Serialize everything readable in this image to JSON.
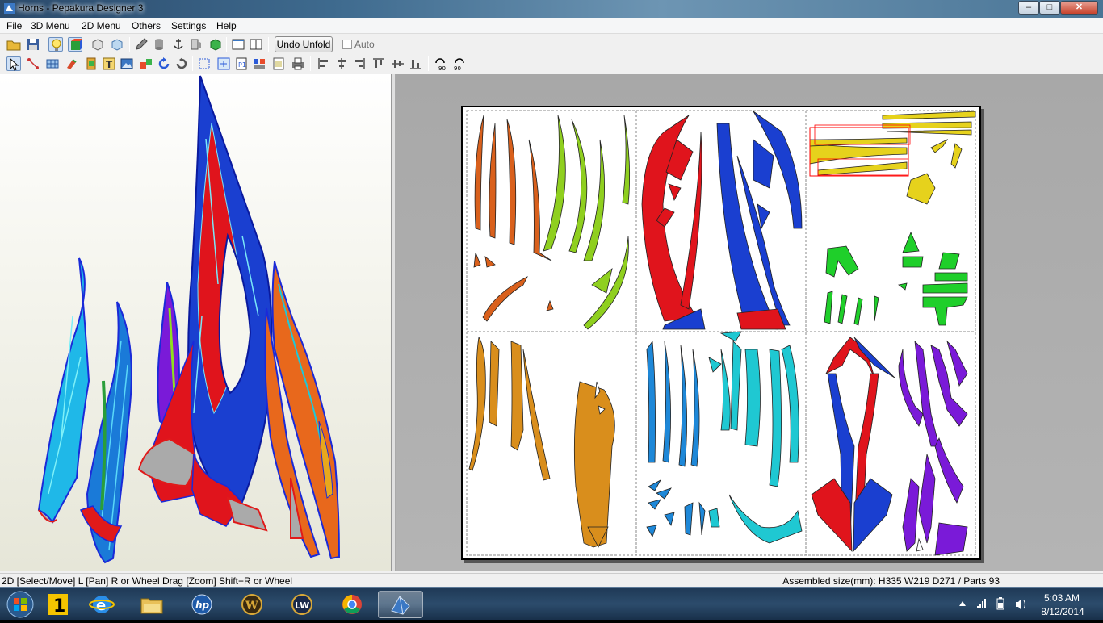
{
  "window": {
    "title": "Horns - Pepakura Designer 3",
    "min_label": "–",
    "max_label": "□",
    "close_label": "✕"
  },
  "menu": {
    "items": [
      "File",
      "3D Menu",
      "2D Menu",
      "Others",
      "Settings",
      "Help"
    ]
  },
  "toolbar": {
    "undo_label": "Undo Unfold",
    "auto_label": "Auto",
    "auto_checked": false
  },
  "status": {
    "left": "2D [Select/Move] L [Pan] R or Wheel Drag [Zoom] Shift+R or Wheel",
    "right": "Assembled size(mm): H335 W219 D271 / Parts 93"
  },
  "taskbar": {
    "time": "5:03 AM",
    "date": "8/12/2014",
    "apps": [
      "start-orb",
      "norton-one",
      "internet-explorer",
      "file-explorer",
      "hp",
      "wow",
      "lw",
      "chrome",
      "pepakura"
    ]
  },
  "colors": {
    "titlebar": "#3e6a8e",
    "viewport2d_bg": "#b0b0b0",
    "part_orange": "#d9601c",
    "part_green": "#8fcf1f",
    "part_red": "#e0141c",
    "part_blue": "#1a3fd0",
    "part_yellow": "#e6d21c",
    "part_bright_green": "#1fcf2a",
    "part_amber": "#d98e1c",
    "part_sky": "#1e88d8",
    "part_cyan": "#1fc8d2",
    "part_purple": "#7a1fd8",
    "selection": "#ff0000"
  }
}
